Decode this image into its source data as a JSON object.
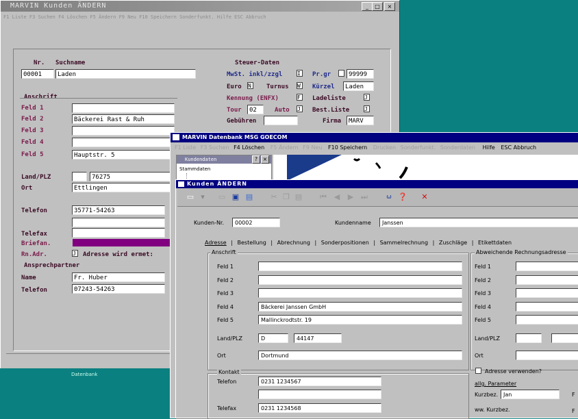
{
  "win1": {
    "title": "MARVIN Kunden  ÄNDERN",
    "menu": "F1 Liste   F3 Suchen   F4 Löschen   F5 Ändern   F9 Neu   F10 Speichern   Sonderfunkt.   Hilfe   ESC Abbruch",
    "nr_label": "Nr.",
    "suchname_label": "Suchname",
    "nr_value": "00001",
    "suchname_value": "Laden",
    "anschrift_label": "Anschrift",
    "feld_labels": [
      "Feld 1",
      "Feld 2",
      "Feld 3",
      "Feld 4",
      "Feld 5"
    ],
    "feld_values": [
      "",
      "Bäckerei Rast & Ruh",
      "",
      "",
      "Hauptstr. 5"
    ],
    "land_plz_label": "Land/PLZ",
    "plz_value": "76275",
    "ort_label": "Ort",
    "ort_value": "Ettlingen",
    "telefon_label": "Telefon",
    "telefon_value": "35771-54263",
    "telefax_label": "Telefax",
    "briefan_label": "Briefan.",
    "rnadr_label": "Rn.Adr.",
    "rnadr_checkbox": "J",
    "rnadr_text": "Adresse wird ermet:",
    "ansprech_label": "Ansprechpartner",
    "name_label": "Name",
    "name_value": "Fr. Huber",
    "telefon2_label": "Telefon",
    "telefon2_value": "07243-54263",
    "steuer_label": "Steuer-Daten",
    "mwst_label": "MwSt. inkl/zzgl",
    "mwst_value": "I",
    "prgr_label": "Pr.gr",
    "prgr_value": "99999",
    "euro_label": "Euro",
    "euro_value": "N",
    "turnus_label": "Turnus",
    "turnus_value": "W",
    "kuerzel_label": "Kürzel",
    "kuerzel_value": "Laden",
    "kennung_label": "Kennung (ENFX)",
    "kennung_value": "F",
    "ladeliste_label": "Ladeliste",
    "ladeliste_value": "J",
    "tour_label": "Tour",
    "tour_value": "02",
    "auto_label": "Auto",
    "auto_value": "J",
    "bestliste_label": "Best.Liste",
    "bestliste_value": "J",
    "gebuehren_label": "Gebühren",
    "firma_label": "Firma",
    "firma_value": "MARV",
    "status_text": "Datenbank"
  },
  "win2": {
    "title": "MARVIN  Datenbank MSG GOECOM",
    "menu_items": [
      "F1 Liste",
      "F3 Suchen",
      "F4 Löschen",
      "F5 Ändern",
      "F9 Neu",
      "F10 Speichern",
      "Drucken",
      "Sonderfunkt.",
      "Sonderdaten",
      "Hilfe",
      "ESC Abbruch"
    ],
    "tree_title": "Kundendaten",
    "tree_items": [
      "Stammdaten"
    ]
  },
  "win3": {
    "title": "Kunden  ÄNDERN",
    "kundennr_label": "Kunden-Nr.",
    "kundennr_value": "00002",
    "kundenname_label": "Kundenname",
    "kundenname_value": "Janssen",
    "tabs": [
      "Adresse",
      "Bestellung",
      "Abrechnung",
      "Sonderpositionen",
      "Sammelrechnung",
      "Zuschläge",
      "Etikettdaten"
    ],
    "anschrift_label": "Anschrift",
    "feld_labels": [
      "Feld 1",
      "Feld 2",
      "Feld 3",
      "Feld 4",
      "Feld 5"
    ],
    "feld_values": [
      "",
      "",
      "",
      "Bäckerei Janssen GmbH",
      "Mallinckrodtstr. 19"
    ],
    "land_plz_label": "Land/PLZ",
    "land_value": "D",
    "plz_value": "44147",
    "ort_label": "Ort",
    "ort_value": "Dortmund",
    "kontakt_label": "Kontakt",
    "telefon_label": "Telefon",
    "telefon_value": "0231 1234567",
    "telefax_label": "Telefax",
    "telefax_value": "0231 1234568",
    "abw_label": "Abweichende Rechnungsadresse",
    "abw_feld_labels": [
      "Feld 1",
      "Feld 2",
      "Feld 3",
      "Feld 4",
      "Feld 5"
    ],
    "abw_land_plz_label": "Land/PLZ",
    "abw_ort_label": "Ort",
    "adresse_verwenden_label": "Adresse verwenden?",
    "allg_param_label": "allg. Parameter",
    "kurzbez_label": "Kurzbez.",
    "kurzbez_value": "Jan",
    "ww_kurzbez_label": "ww. Kurzbez.",
    "right_edge_letter": "F"
  }
}
